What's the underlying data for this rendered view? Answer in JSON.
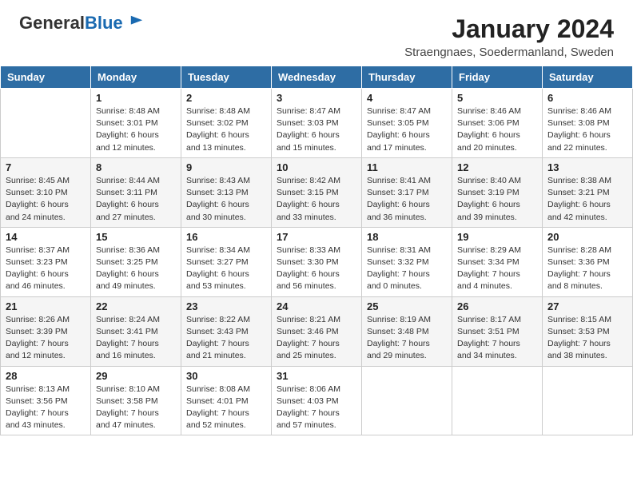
{
  "logo": {
    "general": "General",
    "blue": "Blue"
  },
  "header": {
    "month_year": "January 2024",
    "location": "Straengnaes, Soedermanland, Sweden"
  },
  "days_of_week": [
    "Sunday",
    "Monday",
    "Tuesday",
    "Wednesday",
    "Thursday",
    "Friday",
    "Saturday"
  ],
  "weeks": [
    [
      {
        "day": "",
        "info": ""
      },
      {
        "day": "1",
        "info": "Sunrise: 8:48 AM\nSunset: 3:01 PM\nDaylight: 6 hours\nand 12 minutes."
      },
      {
        "day": "2",
        "info": "Sunrise: 8:48 AM\nSunset: 3:02 PM\nDaylight: 6 hours\nand 13 minutes."
      },
      {
        "day": "3",
        "info": "Sunrise: 8:47 AM\nSunset: 3:03 PM\nDaylight: 6 hours\nand 15 minutes."
      },
      {
        "day": "4",
        "info": "Sunrise: 8:47 AM\nSunset: 3:05 PM\nDaylight: 6 hours\nand 17 minutes."
      },
      {
        "day": "5",
        "info": "Sunrise: 8:46 AM\nSunset: 3:06 PM\nDaylight: 6 hours\nand 20 minutes."
      },
      {
        "day": "6",
        "info": "Sunrise: 8:46 AM\nSunset: 3:08 PM\nDaylight: 6 hours\nand 22 minutes."
      }
    ],
    [
      {
        "day": "7",
        "info": "Sunrise: 8:45 AM\nSunset: 3:10 PM\nDaylight: 6 hours\nand 24 minutes."
      },
      {
        "day": "8",
        "info": "Sunrise: 8:44 AM\nSunset: 3:11 PM\nDaylight: 6 hours\nand 27 minutes."
      },
      {
        "day": "9",
        "info": "Sunrise: 8:43 AM\nSunset: 3:13 PM\nDaylight: 6 hours\nand 30 minutes."
      },
      {
        "day": "10",
        "info": "Sunrise: 8:42 AM\nSunset: 3:15 PM\nDaylight: 6 hours\nand 33 minutes."
      },
      {
        "day": "11",
        "info": "Sunrise: 8:41 AM\nSunset: 3:17 PM\nDaylight: 6 hours\nand 36 minutes."
      },
      {
        "day": "12",
        "info": "Sunrise: 8:40 AM\nSunset: 3:19 PM\nDaylight: 6 hours\nand 39 minutes."
      },
      {
        "day": "13",
        "info": "Sunrise: 8:38 AM\nSunset: 3:21 PM\nDaylight: 6 hours\nand 42 minutes."
      }
    ],
    [
      {
        "day": "14",
        "info": "Sunrise: 8:37 AM\nSunset: 3:23 PM\nDaylight: 6 hours\nand 46 minutes."
      },
      {
        "day": "15",
        "info": "Sunrise: 8:36 AM\nSunset: 3:25 PM\nDaylight: 6 hours\nand 49 minutes."
      },
      {
        "day": "16",
        "info": "Sunrise: 8:34 AM\nSunset: 3:27 PM\nDaylight: 6 hours\nand 53 minutes."
      },
      {
        "day": "17",
        "info": "Sunrise: 8:33 AM\nSunset: 3:30 PM\nDaylight: 6 hours\nand 56 minutes."
      },
      {
        "day": "18",
        "info": "Sunrise: 8:31 AM\nSunset: 3:32 PM\nDaylight: 7 hours\nand 0 minutes."
      },
      {
        "day": "19",
        "info": "Sunrise: 8:29 AM\nSunset: 3:34 PM\nDaylight: 7 hours\nand 4 minutes."
      },
      {
        "day": "20",
        "info": "Sunrise: 8:28 AM\nSunset: 3:36 PM\nDaylight: 7 hours\nand 8 minutes."
      }
    ],
    [
      {
        "day": "21",
        "info": "Sunrise: 8:26 AM\nSunset: 3:39 PM\nDaylight: 7 hours\nand 12 minutes."
      },
      {
        "day": "22",
        "info": "Sunrise: 8:24 AM\nSunset: 3:41 PM\nDaylight: 7 hours\nand 16 minutes."
      },
      {
        "day": "23",
        "info": "Sunrise: 8:22 AM\nSunset: 3:43 PM\nDaylight: 7 hours\nand 21 minutes."
      },
      {
        "day": "24",
        "info": "Sunrise: 8:21 AM\nSunset: 3:46 PM\nDaylight: 7 hours\nand 25 minutes."
      },
      {
        "day": "25",
        "info": "Sunrise: 8:19 AM\nSunset: 3:48 PM\nDaylight: 7 hours\nand 29 minutes."
      },
      {
        "day": "26",
        "info": "Sunrise: 8:17 AM\nSunset: 3:51 PM\nDaylight: 7 hours\nand 34 minutes."
      },
      {
        "day": "27",
        "info": "Sunrise: 8:15 AM\nSunset: 3:53 PM\nDaylight: 7 hours\nand 38 minutes."
      }
    ],
    [
      {
        "day": "28",
        "info": "Sunrise: 8:13 AM\nSunset: 3:56 PM\nDaylight: 7 hours\nand 43 minutes."
      },
      {
        "day": "29",
        "info": "Sunrise: 8:10 AM\nSunset: 3:58 PM\nDaylight: 7 hours\nand 47 minutes."
      },
      {
        "day": "30",
        "info": "Sunrise: 8:08 AM\nSunset: 4:01 PM\nDaylight: 7 hours\nand 52 minutes."
      },
      {
        "day": "31",
        "info": "Sunrise: 8:06 AM\nSunset: 4:03 PM\nDaylight: 7 hours\nand 57 minutes."
      },
      {
        "day": "",
        "info": ""
      },
      {
        "day": "",
        "info": ""
      },
      {
        "day": "",
        "info": ""
      }
    ]
  ]
}
